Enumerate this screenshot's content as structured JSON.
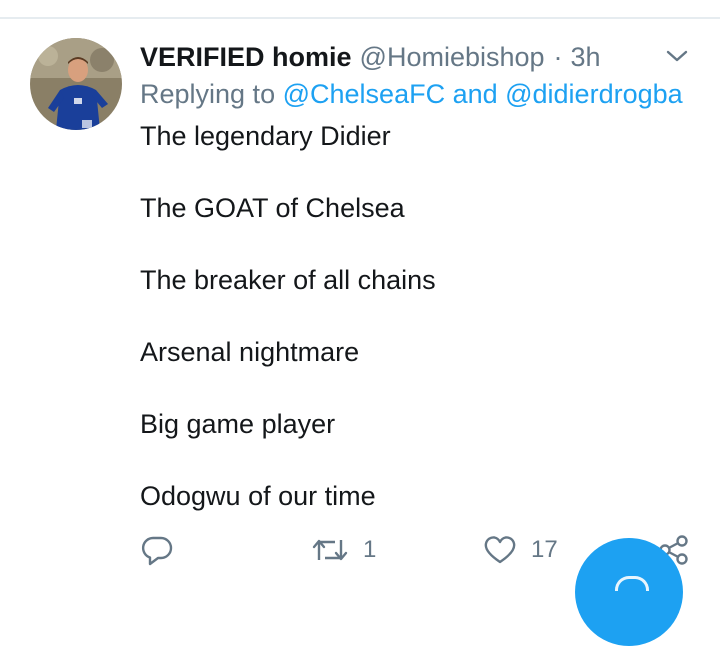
{
  "tweet": {
    "display_name": "VERIFIED homie",
    "handle": "@Homiebishop",
    "separator": "·",
    "time": "3h",
    "replying_prefix": "Replying to",
    "replying_mentions": "@ChelseaFC and @didierdrogba",
    "lines": [
      "The legendary Didier",
      "The GOAT of Chelsea",
      "The breaker of all chains",
      "Arsenal nightmare",
      "Big game player",
      "Odogwu of our time"
    ]
  },
  "actions": {
    "reply": {
      "icon": "reply-icon",
      "count": ""
    },
    "retweet": {
      "icon": "retweet-icon",
      "count": "1"
    },
    "like": {
      "icon": "heart-icon",
      "count": "17"
    },
    "share": {
      "icon": "share-icon",
      "count": ""
    }
  },
  "icons": {
    "menu": "chevron-down-icon",
    "compose": "compose-fab-icon"
  },
  "colors": {
    "accent": "#1da1f2",
    "text": "#14171a",
    "muted": "#657786",
    "divider": "#e6ecf0"
  }
}
